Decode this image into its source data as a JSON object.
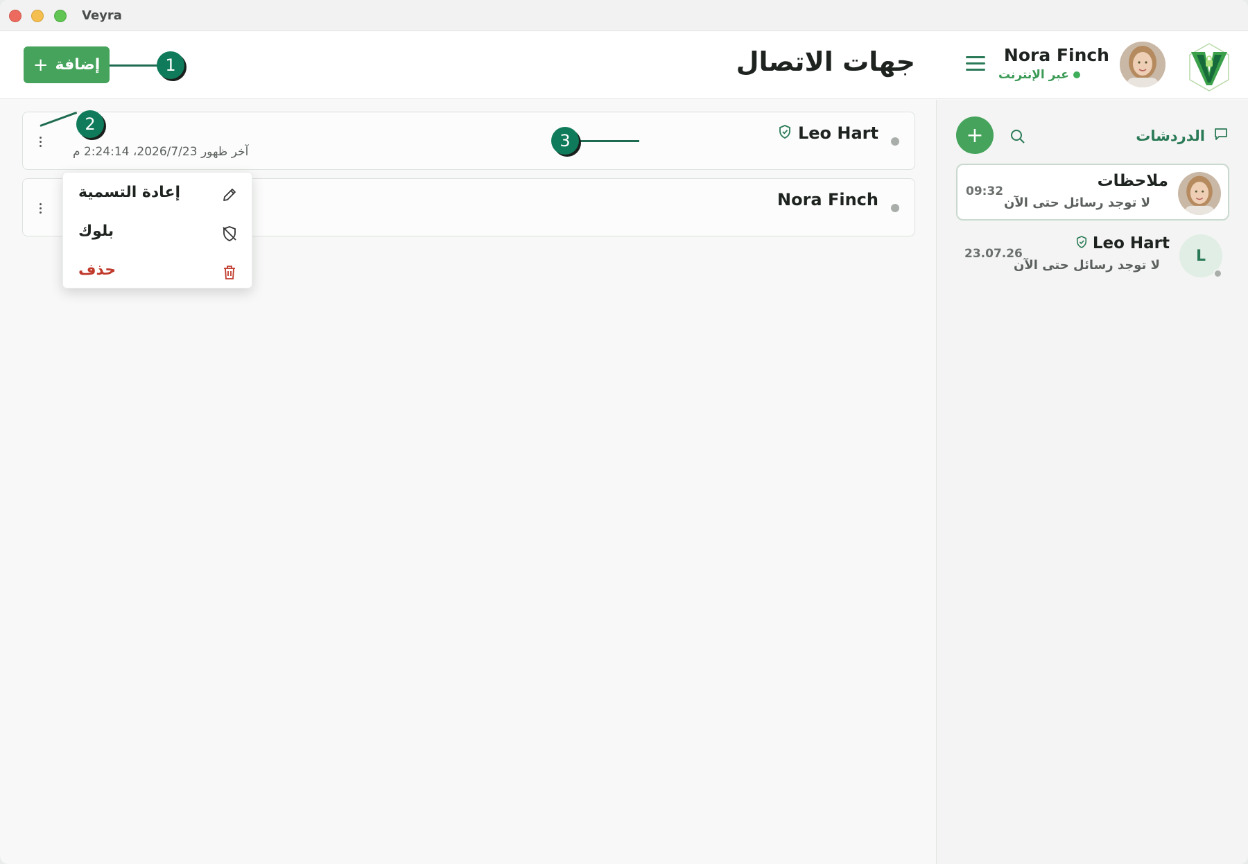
{
  "window": {
    "title": "Veyra"
  },
  "header": {
    "add_button_label": "إضافة",
    "add_button_icon": "plus-icon",
    "page_title": "جهات الاتصال",
    "user": {
      "name": "Nora Finch",
      "status": "عبر الإنترنت"
    }
  },
  "contacts": [
    {
      "name": "Leo Hart",
      "verified": true,
      "last_seen": "آخر ظهور 2026/7/23، 2:24:14 م"
    },
    {
      "name": "Nora Finch",
      "verified": false,
      "last_seen": ""
    }
  ],
  "context_menu": {
    "items": [
      {
        "label": "إعادة التسمية",
        "icon": "pencil-icon"
      },
      {
        "label": "بلوك",
        "icon": "shield-off-icon"
      },
      {
        "label": "حذف",
        "icon": "trash-icon",
        "color": "#c0392b"
      }
    ]
  },
  "callouts": [
    "1",
    "2",
    "3"
  ],
  "sidebar": {
    "title": "الدردشات",
    "chats": [
      {
        "name": "ملاحظات",
        "preview": "لا توجد رسائل حتى الآن",
        "time": "09:32"
      },
      {
        "name": "Leo Hart",
        "avatar_letter": "L",
        "preview": "لا توجد رسائل حتى الآن",
        "time": "23.07.26"
      }
    ]
  },
  "colors": {
    "accent": "#45a35b",
    "brand_dark": "#2b7a57",
    "callout": "#0f7b5a",
    "danger": "#c0392b"
  }
}
